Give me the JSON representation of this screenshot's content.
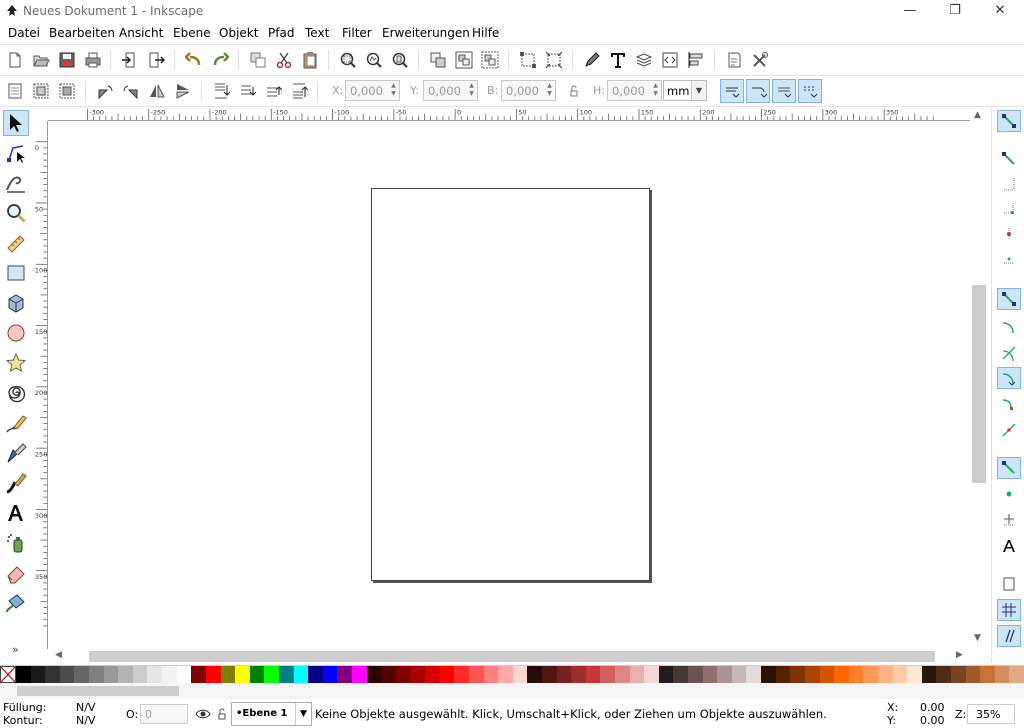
{
  "window": {
    "title": "Neues Dokument 1 - Inkscape",
    "minimize_glyph": "—",
    "maximize_glyph": "❐",
    "close_glyph": "✕"
  },
  "menu": [
    "Datei",
    "Bearbeiten",
    "Ansicht",
    "Ebene",
    "Objekt",
    "Pfad",
    "Text",
    "Filter",
    "Erweiterungen",
    "Hilfe"
  ],
  "commands": [
    "new-document-icon",
    "open-icon",
    "save-icon",
    "print-icon",
    "import-icon",
    "export-icon",
    "undo-icon",
    "redo-icon",
    "duplicate-icon",
    "cut-icon",
    "paste-icon",
    "zoom-selection-icon",
    "zoom-drawing-icon",
    "zoom-page-icon",
    "clone-icon",
    "group-icon",
    "ungroup-icon",
    "node-snap-icon",
    "bbox-snap-icon",
    "fill-stroke-icon",
    "text-font-icon",
    "layers-icon",
    "xml-editor-icon",
    "align-icon",
    "document-properties-icon",
    "preferences-icon"
  ],
  "tool_options": {
    "x_label": "X:",
    "x_value": "0,000",
    "y_label": "Y:",
    "y_value": "0,000",
    "w_label": "B:",
    "w_value": "0,000",
    "h_label": "H:",
    "h_value": "0,000",
    "unit": "mm"
  },
  "ruler": {
    "top_labels": [
      "-300",
      "-250",
      "-200",
      "-150",
      "-100",
      "-50",
      "0",
      "50",
      "100",
      "150",
      "200",
      "250",
      "300",
      "350",
      "400",
      "450"
    ],
    "left_labels": [
      "0",
      "50",
      "100",
      "150",
      "200",
      "250",
      "300",
      "350"
    ]
  },
  "tools": [
    "selector-tool-icon",
    "node-tool-icon",
    "tweak-tool-icon",
    "zoom-tool-icon",
    "measure-tool-icon",
    "rect-tool-icon",
    "3dbox-tool-icon",
    "ellipse-tool-icon",
    "star-tool-icon",
    "spiral-tool-icon",
    "pencil-tool-icon",
    "pen-tool-icon",
    "calligraphy-tool-icon",
    "text-tool-icon",
    "spray-tool-icon",
    "eraser-tool-icon",
    "paint-bucket-tool-icon"
  ],
  "toolbox_more": "»",
  "palette_colors": [
    "#000000",
    "#1a1a1a",
    "#333333",
    "#4d4d4d",
    "#666666",
    "#808080",
    "#999999",
    "#b3b3b3",
    "#cccccc",
    "#e6e6e6",
    "#f2f2f2",
    "#ffffff",
    "#800000",
    "#ff0000",
    "#808000",
    "#ffff00",
    "#008000",
    "#00ff00",
    "#008080",
    "#00ffff",
    "#000080",
    "#0000ff",
    "#800080",
    "#ff00ff",
    "#2b0000",
    "#550000",
    "#800000",
    "#aa0000",
    "#d40000",
    "#ff0000",
    "#ff2a2a",
    "#ff5555",
    "#ff8080",
    "#ffaaaa",
    "#ffd5d5",
    "#280b0b",
    "#501616",
    "#782121",
    "#a02c2c",
    "#c83737",
    "#d35f5f",
    "#de8787",
    "#e9afaf",
    "#f4d7d7",
    "#241c1c",
    "#483737",
    "#6c5353",
    "#916f6f",
    "#ac9393",
    "#c8b7b7",
    "#e3dbdb",
    "#2b1100",
    "#552200",
    "#803300",
    "#aa4400",
    "#d45500",
    "#ff6600",
    "#ff7f2a",
    "#ff9955",
    "#ffb380",
    "#ffccaa",
    "#ffe6d5",
    "#28170b",
    "#502d16",
    "#784421",
    "#a05a2c",
    "#c87137",
    "#d38d5f",
    "#deaa87"
  ],
  "status": {
    "fill_label": "Füllung:",
    "fill_value": "N/V",
    "stroke_label": "Kontur:",
    "stroke_value": "N/V",
    "opacity_label": "O:",
    "opacity_value": "0",
    "layer": "•Ebene 1",
    "message": "Keine Objekte ausgewählt. Klick, Umschalt+Klick, oder Ziehen um Objekte auszuwählen.",
    "x_label": "X:",
    "x_value": "0.00",
    "y_label": "Y:",
    "y_value": "0.00",
    "zoom_label": "Z:",
    "zoom_value": "35%"
  }
}
